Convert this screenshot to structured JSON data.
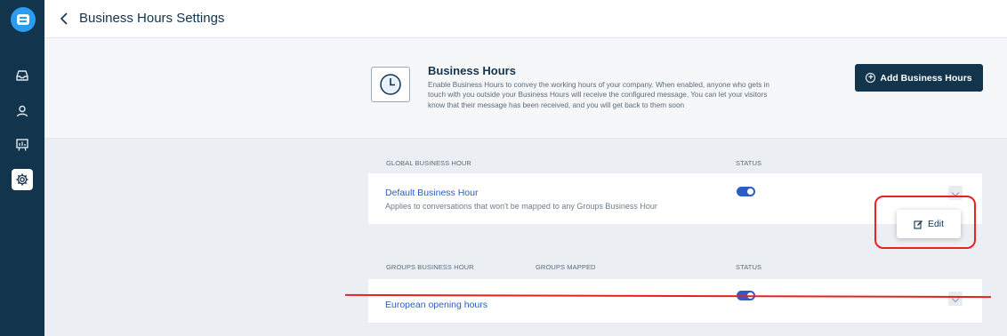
{
  "header": {
    "title": "Business Hours Settings"
  },
  "intro": {
    "title": "Business Hours",
    "description": "Enable Business Hours to convey the working hours of your company. When enabled, anyone who gets in touch with you outside your Business Hours will receive the configured message. You can let your visitors know that their message has been received, and you will get back to them soon",
    "add_button_label": "Add Business Hours"
  },
  "global_section": {
    "header_label": "GLOBAL BUSINESS HOUR",
    "status_label": "STATUS",
    "row": {
      "name": "Default Business Hour",
      "description": "Applies to conversations that won't be mapped to any Groups Business Hour",
      "status_enabled": true
    }
  },
  "groups_section": {
    "header_label": "GROUPS BUSINESS HOUR",
    "mapped_label": "GROUPS MAPPED",
    "status_label": "STATUS",
    "rows": [
      {
        "name": "European opening hours",
        "status_enabled": true
      }
    ]
  },
  "popover": {
    "edit_label": "Edit"
  },
  "colors": {
    "sidebar": "#12344d",
    "accent": "#2c5cc5",
    "annotation": "#e8231f"
  },
  "icons": [
    "chat-logo-icon",
    "inbox-icon",
    "contacts-icon",
    "analytics-icon",
    "settings-gear-icon",
    "back-chevron-icon",
    "clock-icon",
    "plus-circle-icon",
    "edit-icon",
    "chevron-down-icon"
  ]
}
